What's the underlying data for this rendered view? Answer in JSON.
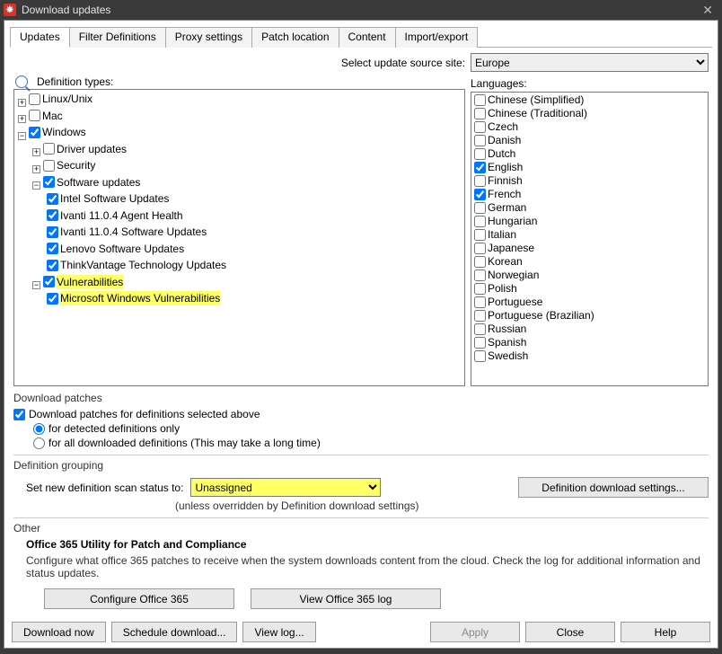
{
  "title": "Download updates",
  "tabs": [
    "Updates",
    "Filter Definitions",
    "Proxy settings",
    "Patch location",
    "Content",
    "Import/export"
  ],
  "site": {
    "label": "Select update source site:",
    "value": "Europe"
  },
  "def_types_label": "Definition types:",
  "languages_label": "Languages:",
  "tree": {
    "linux": "Linux/Unix",
    "mac": "Mac",
    "windows": "Windows",
    "driver": "Driver updates",
    "security": "Security",
    "software": "Software updates",
    "sw_children": [
      "Intel Software Updates",
      "Ivanti 11.0.4 Agent Health",
      "Ivanti 11.0.4 Software Updates",
      "Lenovo Software Updates",
      "ThinkVantage Technology Updates"
    ],
    "vuln": "Vulnerabilities",
    "msvuln": "Microsoft Windows Vulnerabilities"
  },
  "languages": [
    {
      "label": "Chinese (Simplified)",
      "checked": false
    },
    {
      "label": "Chinese (Traditional)",
      "checked": false
    },
    {
      "label": "Czech",
      "checked": false
    },
    {
      "label": "Danish",
      "checked": false
    },
    {
      "label": "Dutch",
      "checked": false
    },
    {
      "label": "English",
      "checked": true
    },
    {
      "label": "Finnish",
      "checked": false
    },
    {
      "label": "French",
      "checked": true
    },
    {
      "label": "German",
      "checked": false
    },
    {
      "label": "Hungarian",
      "checked": false
    },
    {
      "label": "Italian",
      "checked": false
    },
    {
      "label": "Japanese",
      "checked": false
    },
    {
      "label": "Korean",
      "checked": false
    },
    {
      "label": "Norwegian",
      "checked": false
    },
    {
      "label": "Polish",
      "checked": false
    },
    {
      "label": "Portuguese",
      "checked": false
    },
    {
      "label": "Portuguese (Brazilian)",
      "checked": false
    },
    {
      "label": "Russian",
      "checked": false
    },
    {
      "label": "Spanish",
      "checked": false
    },
    {
      "label": "Swedish",
      "checked": false
    }
  ],
  "download_patches": {
    "group": "Download patches",
    "chk": "Download patches for definitions selected above",
    "r1": "for detected definitions only",
    "r2": "for all downloaded definitions (This may take a long time)"
  },
  "definition_grouping": {
    "group": "Definition grouping",
    "label": "Set new definition scan status to:",
    "value": "Unassigned",
    "note": "(unless overridden by Definition download settings)",
    "btn": "Definition download settings..."
  },
  "other": {
    "group": "Other",
    "title": "Office 365 Utility for Patch and Compliance",
    "desc": "Configure what office 365 patches to receive when the system downloads content from the cloud. Check the log for additional information and status updates.",
    "b1": "Configure Office 365",
    "b2": "View Office 365 log"
  },
  "footer": {
    "dl": "Download now",
    "sched": "Schedule download...",
    "log": "View log...",
    "apply": "Apply",
    "close": "Close",
    "help": "Help"
  }
}
